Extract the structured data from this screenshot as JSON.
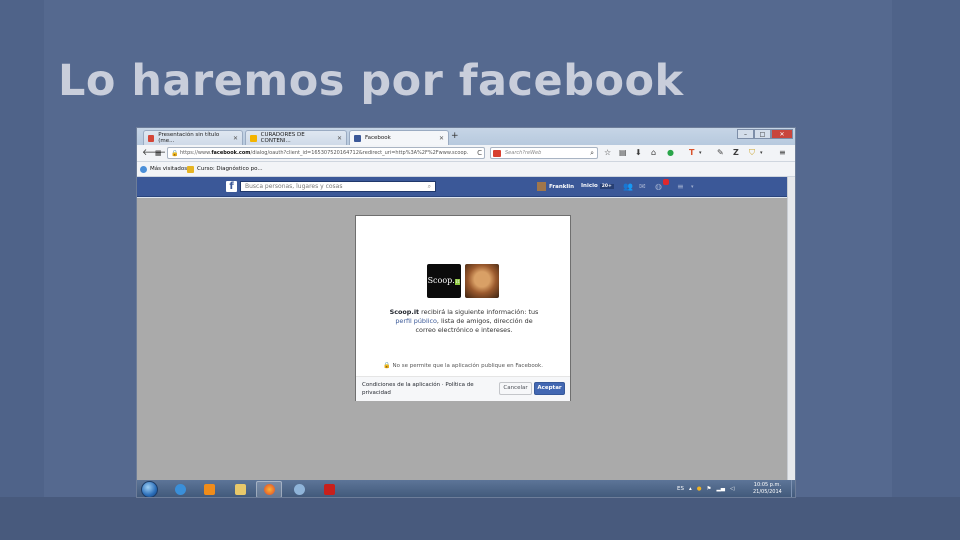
{
  "slide": {
    "title": "Lo haremos por facebook"
  },
  "browser": {
    "tabs": [
      {
        "label": "Presentación sin título (me...",
        "favicon": "gmail-icon",
        "active": false
      },
      {
        "label": "CURADORES DE CONTENI...",
        "favicon": "slides-icon",
        "active": false
      },
      {
        "label": "Facebook",
        "favicon": "facebook-icon",
        "active": true
      }
    ],
    "url_prefix": "https://www.",
    "url_domain": "facebook.com",
    "url_rest": "/dialog/oauth?client_id=165307520164712&redirect_uri=http%3A%2F%2Fwww.scoop.",
    "search_placeholder": "Search?reWeb",
    "bookmarks": [
      {
        "label": "Más visitados"
      },
      {
        "label": "Curso: Diagnóstico po..."
      }
    ]
  },
  "facebook": {
    "search_placeholder": "Busca personas, lugares y cosas",
    "user_name": "Franklin",
    "home_label": "Inicio",
    "home_count": "20+"
  },
  "dialog": {
    "app_logo_text": "Scoop.",
    "app_logo_suffix": "it",
    "app_name": "Scoop.it",
    "perm_text_1": " recibirá la siguiente información: tus ",
    "perm_link": "perfil público",
    "perm_text_2": ", lista de amigos, dirección de correo electrónico e intereses.",
    "notice": "No se permite que la aplicación publique en Facebook.",
    "footer_links": "Condiciones de la aplicación · Política de privacidad",
    "cancel_label": "Cancelar",
    "accept_label": "Aceptar"
  },
  "taskbar": {
    "language": "ES",
    "time": "10:05 p.m.",
    "date": "21/05/2014"
  },
  "colors": {
    "slide_bg": "#55698f",
    "facebook_blue": "#3b5898",
    "accept_button": "#4267b2",
    "overlay_gray": "#aaaaaa"
  }
}
